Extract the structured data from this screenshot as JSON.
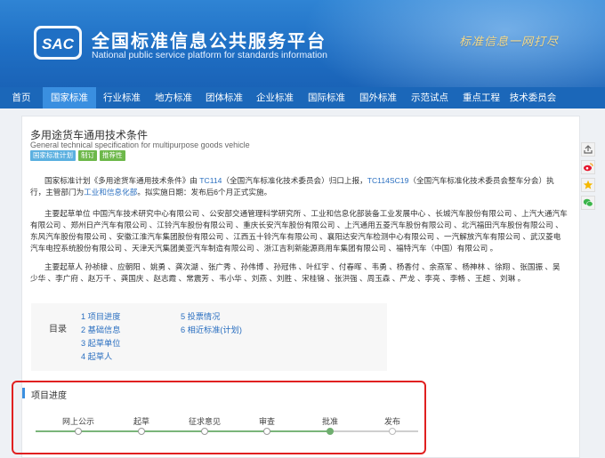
{
  "header": {
    "title": "全国标准信息公共服务平台",
    "subtitle": "National public service platform  for standards information",
    "slogan": "标准信息一网打尽",
    "logo_text": "SAC"
  },
  "nav": {
    "items": [
      {
        "label": "首页",
        "width": 48
      },
      {
        "label": "国家标准",
        "width": 60,
        "active": true
      },
      {
        "label": "行业标准",
        "width": 58
      },
      {
        "label": "地方标准",
        "width": 58
      },
      {
        "label": "团体标准",
        "width": 56
      },
      {
        "label": "企业标准",
        "width": 58
      },
      {
        "label": "国际标准",
        "width": 58
      },
      {
        "label": "国外标准",
        "width": 58
      },
      {
        "label": "示范试点",
        "width": 58
      },
      {
        "label": "重点工程",
        "width": 58
      },
      {
        "label": "技术委员会",
        "width": 58
      }
    ]
  },
  "standard": {
    "title_cn": "多用途货车通用技术条件",
    "title_en": "General technical specification for multipurpose goods vehicle",
    "tags": [
      "国家标准计划",
      "制订",
      "推荐性"
    ]
  },
  "paragraphs": {
    "p1_a": "国家标准计划《多用途货车通用技术条件》由 ",
    "p1_tc": "TC114",
    "p1_b": "（全国汽车标准化技术委员会）归口上报，",
    "p1_sc": "TC114SC19",
    "p1_c": "（全国汽车标准化技术委员会整车分会）执行，主管部门为",
    "p1_dept": "工业和信息化部",
    "p1_d": "。拟实施日期：发布后6个月正式实施。",
    "p2": "主要起草单位 中国汽车技术研究中心有限公司 、公安部交通管理科学研究所 、工业和信息化部装备工业发展中心 、长城汽车股份有限公司 、上汽大通汽车有限公司 、郑州日产汽车有限公司 、江铃汽车股份有限公司 、重庆长安汽车股份有限公司 、上汽通用五菱汽车股份有限公司 、北汽福田汽车股份有限公司 、东风汽车股份有限公司 、安徽江淮汽车集团股份有限公司 、江西五十铃汽车有限公司 、襄阳达安汽车检测中心有限公司 、一汽解放汽车有限公司 、武汉菱电汽车电控系统股份有限公司 、天津天汽集团美亚汽车制造有限公司 、浙江吉利新能源商用车集团有限公司 、福特汽车（中国）有限公司 。",
    "p3": "主要起草人 孙祯棣 、应朝阳 、姚勇 、龚次湖 、张广秀 、孙伟博 、孙冠伟 、叶红宇 、付春晖 、韦勇 、杨香付 、余燕军 、杨神林 、徐翔 、张国振 、吴少华 、李广府 、赵万千 、龚国庆 、赵志霞 、常震芳 、韦小华 、刘燕 、刘胜 、宋桂锦 、张洪强 、周玉森 、严龙 、李亮 、李畅 、王超 、刘琳 。"
  },
  "toc": {
    "label": "目录",
    "col1": [
      "1 项目进度",
      "2 基础信息",
      "3 起草单位",
      "4 起草人"
    ],
    "col2": [
      "5 投票情况",
      "6 相近标准(计划)"
    ]
  },
  "progress": {
    "title": "项目进度",
    "stages": [
      "网上公示",
      "起草",
      "征求意见",
      "审查",
      "批准",
      "发布"
    ],
    "current_index": 4
  }
}
